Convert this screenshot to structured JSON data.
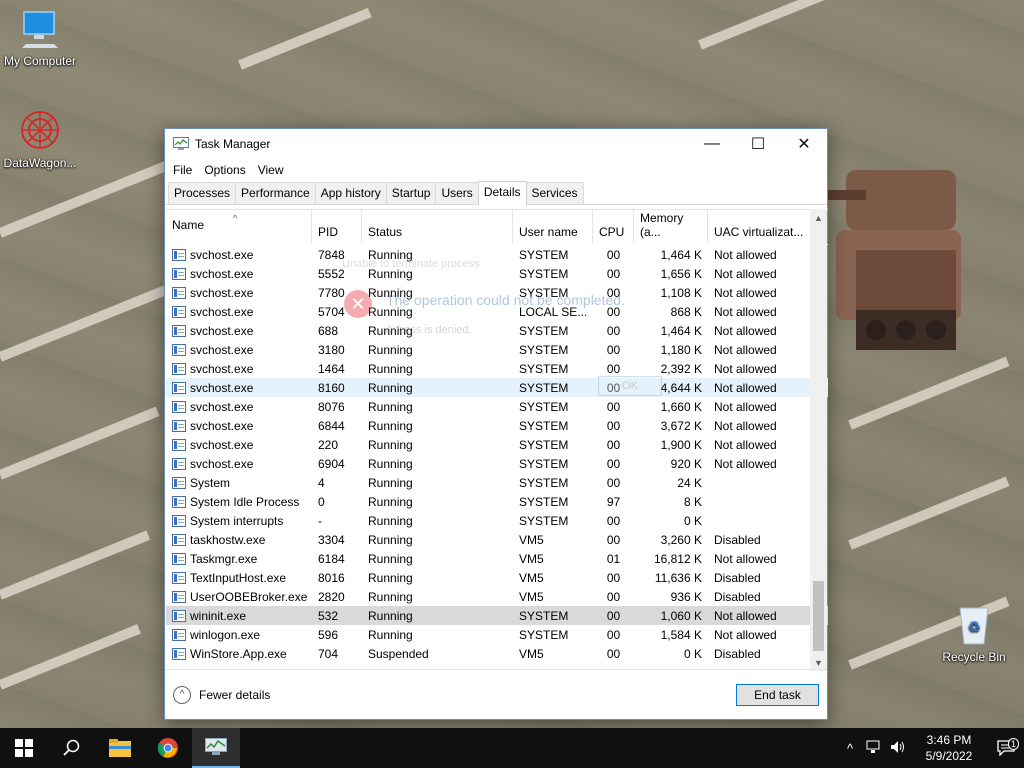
{
  "desktop": {
    "icons": [
      {
        "label": "My Computer",
        "icon": "monitor-icon"
      },
      {
        "label": "DataWagon...",
        "icon": "datawagon-app-icon"
      },
      {
        "label": "Recycle Bin",
        "icon": "recycle-bin-icon"
      }
    ]
  },
  "window": {
    "title": "Task Manager",
    "controls": {
      "minimize": "—",
      "maximize": "☐",
      "close": "✕"
    },
    "menu": [
      "File",
      "Options",
      "View"
    ],
    "tabs": [
      "Processes",
      "Performance",
      "App history",
      "Startup",
      "Users",
      "Details",
      "Services"
    ],
    "active_tab": "Details",
    "columns": [
      "Name",
      "PID",
      "Status",
      "User name",
      "CPU",
      "Memory (a...",
      "UAC virtualizat..."
    ],
    "rows": [
      {
        "name": "svchost.exe",
        "pid": "7848",
        "status": "Running",
        "user": "SYSTEM",
        "cpu": "00",
        "mem": "1,464 K",
        "uac": "Not allowed"
      },
      {
        "name": "svchost.exe",
        "pid": "5552",
        "status": "Running",
        "user": "SYSTEM",
        "cpu": "00",
        "mem": "1,656 K",
        "uac": "Not allowed"
      },
      {
        "name": "svchost.exe",
        "pid": "7780",
        "status": "Running",
        "user": "SYSTEM",
        "cpu": "00",
        "mem": "1,108 K",
        "uac": "Not allowed"
      },
      {
        "name": "svchost.exe",
        "pid": "5704",
        "status": "Running",
        "user": "LOCAL SE...",
        "cpu": "00",
        "mem": "868 K",
        "uac": "Not allowed"
      },
      {
        "name": "svchost.exe",
        "pid": "688",
        "status": "Running",
        "user": "SYSTEM",
        "cpu": "00",
        "mem": "1,464 K",
        "uac": "Not allowed"
      },
      {
        "name": "svchost.exe",
        "pid": "3180",
        "status": "Running",
        "user": "SYSTEM",
        "cpu": "00",
        "mem": "1,180 K",
        "uac": "Not allowed"
      },
      {
        "name": "svchost.exe",
        "pid": "1464",
        "status": "Running",
        "user": "SYSTEM",
        "cpu": "00",
        "mem": "2,392 K",
        "uac": "Not allowed"
      },
      {
        "name": "svchost.exe",
        "pid": "8160",
        "status": "Running",
        "user": "SYSTEM",
        "cpu": "00",
        "mem": "4,644 K",
        "uac": "Not allowed"
      },
      {
        "name": "svchost.exe",
        "pid": "8076",
        "status": "Running",
        "user": "SYSTEM",
        "cpu": "00",
        "mem": "1,660 K",
        "uac": "Not allowed"
      },
      {
        "name": "svchost.exe",
        "pid": "6844",
        "status": "Running",
        "user": "SYSTEM",
        "cpu": "00",
        "mem": "3,672 K",
        "uac": "Not allowed"
      },
      {
        "name": "svchost.exe",
        "pid": "220",
        "status": "Running",
        "user": "SYSTEM",
        "cpu": "00",
        "mem": "1,900 K",
        "uac": "Not allowed"
      },
      {
        "name": "svchost.exe",
        "pid": "6904",
        "status": "Running",
        "user": "SYSTEM",
        "cpu": "00",
        "mem": "920 K",
        "uac": "Not allowed"
      },
      {
        "name": "System",
        "pid": "4",
        "status": "Running",
        "user": "SYSTEM",
        "cpu": "00",
        "mem": "24 K",
        "uac": ""
      },
      {
        "name": "System Idle Process",
        "pid": "0",
        "status": "Running",
        "user": "SYSTEM",
        "cpu": "97",
        "mem": "8 K",
        "uac": ""
      },
      {
        "name": "System interrupts",
        "pid": "-",
        "status": "Running",
        "user": "SYSTEM",
        "cpu": "00",
        "mem": "0 K",
        "uac": ""
      },
      {
        "name": "taskhostw.exe",
        "pid": "3304",
        "status": "Running",
        "user": "VM5",
        "cpu": "00",
        "mem": "3,260 K",
        "uac": "Disabled"
      },
      {
        "name": "Taskmgr.exe",
        "pid": "6184",
        "status": "Running",
        "user": "VM5",
        "cpu": "01",
        "mem": "16,812 K",
        "uac": "Not allowed"
      },
      {
        "name": "TextInputHost.exe",
        "pid": "8016",
        "status": "Running",
        "user": "VM5",
        "cpu": "00",
        "mem": "11,636 K",
        "uac": "Disabled"
      },
      {
        "name": "UserOOBEBroker.exe",
        "pid": "2820",
        "status": "Running",
        "user": "VM5",
        "cpu": "00",
        "mem": "936 K",
        "uac": "Disabled"
      },
      {
        "name": "wininit.exe",
        "pid": "532",
        "status": "Running",
        "user": "SYSTEM",
        "cpu": "00",
        "mem": "1,060 K",
        "uac": "Not allowed"
      },
      {
        "name": "winlogon.exe",
        "pid": "596",
        "status": "Running",
        "user": "SYSTEM",
        "cpu": "00",
        "mem": "1,584 K",
        "uac": "Not allowed"
      },
      {
        "name": "WinStore.App.exe",
        "pid": "704",
        "status": "Suspended",
        "user": "VM5",
        "cpu": "00",
        "mem": "0 K",
        "uac": "Disabled"
      }
    ],
    "selected_row_pid": "8160",
    "highlighted_row_pid": "532",
    "fewer_details_label": "Fewer details",
    "end_task_label": "End task"
  },
  "ghost_dialog": {
    "caption": "Unable to terminate process",
    "message": "The operation could not be completed.",
    "detail": "Access is denied.",
    "ok_label": "OK"
  },
  "taskbar": {
    "apps": [
      "start-icon",
      "search-icon",
      "file-explorer-icon",
      "chrome-icon",
      "task-manager-icon"
    ],
    "active_app": "task-manager-icon",
    "time": "3:46 PM",
    "date": "5/9/2022",
    "notification_count": "1"
  }
}
